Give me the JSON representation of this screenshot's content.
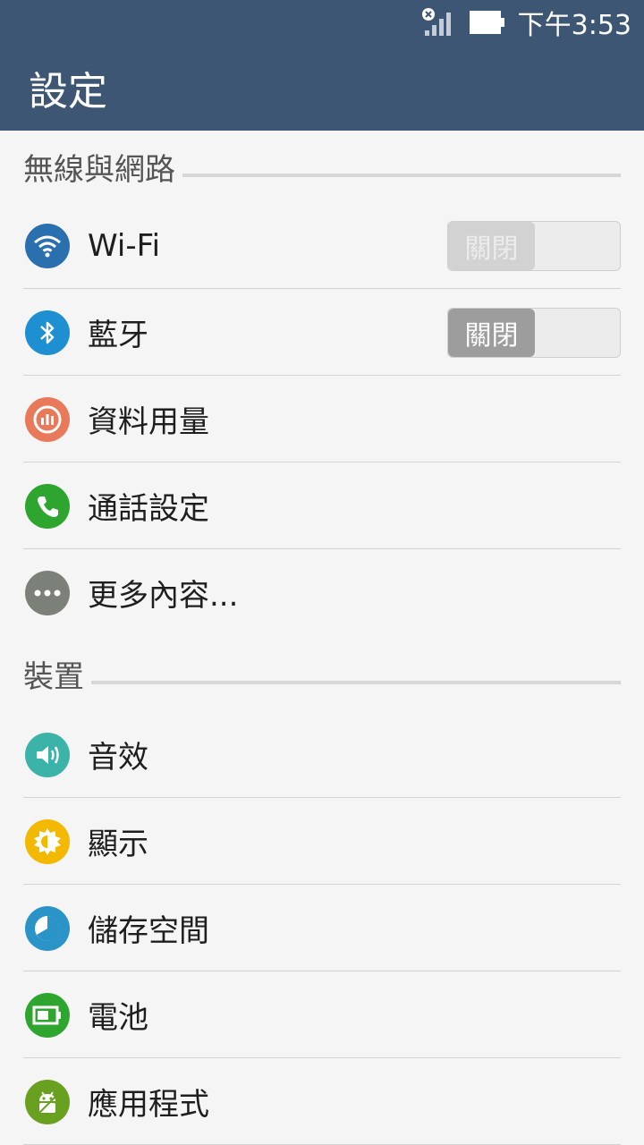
{
  "status": {
    "time": "下午3:53"
  },
  "app_bar": {
    "title": "設定"
  },
  "sections": [
    {
      "header": "無線與網路",
      "items": [
        {
          "label": "Wi-Fi",
          "icon": "wifi-icon",
          "color": "#2a6fae",
          "toggle": "關閉",
          "toggle_enabled": false
        },
        {
          "label": "藍牙",
          "icon": "bluetooth-icon",
          "color": "#1e8fd0",
          "toggle": "關閉",
          "toggle_enabled": true
        },
        {
          "label": "資料用量",
          "icon": "data-usage-icon",
          "color": "#e8795a"
        },
        {
          "label": "通話設定",
          "icon": "phone-icon",
          "color": "#2ea52e"
        },
        {
          "label": "更多內容...",
          "icon": "more-icon",
          "color": "#7b8078"
        }
      ]
    },
    {
      "header": "裝置",
      "items": [
        {
          "label": "音效",
          "icon": "sound-icon",
          "color": "#3bb3a8"
        },
        {
          "label": "顯示",
          "icon": "display-icon",
          "color": "#f3b800"
        },
        {
          "label": "儲存空間",
          "icon": "storage-icon",
          "color": "#2a94c8"
        },
        {
          "label": "電池",
          "icon": "battery-icon",
          "color": "#2ea52e"
        },
        {
          "label": "應用程式",
          "icon": "android-icon",
          "color": "#6aa020"
        }
      ]
    }
  ]
}
